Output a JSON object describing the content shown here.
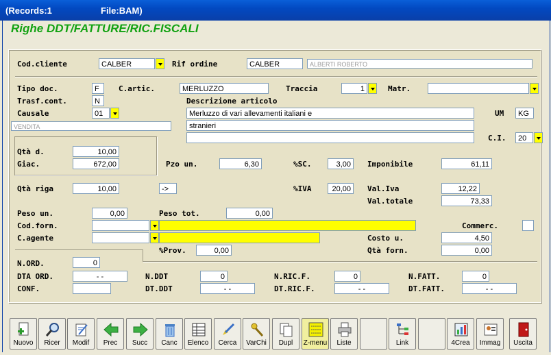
{
  "window": {
    "records": "(Records:1",
    "file": "File:BAM)"
  },
  "heading": "Righe DDT/FATTURE/RIC.FISCALI",
  "labels": {
    "cod_cliente": "Cod.cliente",
    "rif_ordine": "Rif ordine",
    "tipo_doc": "Tipo doc.",
    "c_artic": "C.artic.",
    "traccia": "Traccia",
    "matr": "Matr.",
    "trasf_cont": "Trasf.cont.",
    "descrizione": "Descrizione articolo",
    "causale": "Causale",
    "um": "UM",
    "ci": "C.I.",
    "qta_d": "Qtà d.",
    "giac": "Giac.",
    "pzo_un": "Pzo un.",
    "sc": "%SC.",
    "imponibile": "Imponibile",
    "qta_riga": "Qtà riga",
    "iva": "%IVA",
    "val_iva": "Val.Iva",
    "val_totale": "Val.totale",
    "peso_un": "Peso un.",
    "peso_tot": "Peso tot.",
    "cod_forn": "Cod.forn.",
    "commerc": "Commerc.",
    "c_agente": "C.agente",
    "costo_u": "Costo u.",
    "prov": "%Prov.",
    "qta_forn": "Qtà forn.",
    "n_ord": "N.ORD.",
    "dta_ord": "DTA ORD.",
    "n_ddt": "N.DDT",
    "n_ric_f": "N.RIC.F.",
    "n_fatt": "N.FATT.",
    "conf": "CONF.",
    "dt_ddt": "DT.DDT",
    "dt_ric_f": "DT.RIC.F.",
    "dt_fatt": "DT.FATT."
  },
  "values": {
    "cod_cliente": "CALBER",
    "rif_ordine": "CALBER",
    "cliente_nome": "ALBERTI ROBERTO",
    "tipo_doc": "F",
    "c_artic": "MERLUZZO",
    "traccia": "1",
    "matr": "",
    "trasf_cont": "N",
    "causale": "01",
    "causale_desc": "VENDITA",
    "descr1": "Merluzzo di vari allevamenti italiani e",
    "descr2": "stranieri",
    "descr3": "",
    "um": "KG",
    "ci": "20",
    "qta_d": "10,00",
    "giac": "672,00",
    "pzo_un": "6,30",
    "sc": "3,00",
    "imponibile": "61,11",
    "qta_riga": "10,00",
    "arrow": "->",
    "iva": "20,00",
    "val_iva": "12,22",
    "val_totale": "73,33",
    "peso_un": "0,00",
    "peso_tot": "0,00",
    "cod_forn": "",
    "cod_forn_desc": "",
    "commerc": "",
    "c_agente": "",
    "c_agente_desc": "",
    "costo_u": "4,50",
    "prov": "0,00",
    "qta_forn": "0,00",
    "n_ord": "0",
    "dta_ord": "-   -",
    "n_ddt": "0",
    "n_ric_f": "0",
    "n_fatt": "0",
    "conf": "",
    "dt_ddt": "-   -",
    "dt_ric_f": "-   -",
    "dt_fatt": "-   -"
  },
  "toolbar": [
    {
      "name": "nuovo",
      "label": "Nuovo",
      "icon": "new-doc-plus-icon"
    },
    {
      "name": "ricer",
      "label": "Ricer",
      "icon": "magnifier-icon"
    },
    {
      "name": "modif",
      "label": "Modif",
      "icon": "edit-doc-icon"
    },
    {
      "name": "prec",
      "label": "Prec",
      "icon": "arrow-left-icon"
    },
    {
      "name": "succ",
      "label": "Succ",
      "icon": "arrow-right-icon"
    },
    {
      "name": "canc",
      "label": "Canc",
      "icon": "trash-icon"
    },
    {
      "name": "elenco",
      "label": "Elenco",
      "icon": "list-icon"
    },
    {
      "name": "cerca",
      "label": "Cerca",
      "icon": "find-icon"
    },
    {
      "name": "varchi",
      "label": "VarChi",
      "icon": "keys-icon"
    },
    {
      "name": "dupl",
      "label": "Dupl",
      "icon": "duplicate-icon"
    },
    {
      "name": "zmenu",
      "label": "Z-menu",
      "icon": "zmenu-icon"
    },
    {
      "name": "liste",
      "label": "Liste",
      "icon": "printer-icon"
    },
    {
      "name": "link",
      "label": "Link",
      "icon": "tree-icon"
    },
    {
      "name": "4crea",
      "label": "4Crea",
      "icon": "chart-icon"
    },
    {
      "name": "immag",
      "label": "Immag",
      "icon": "image-icon"
    },
    {
      "name": "uscita",
      "label": "Uscita",
      "icon": "exit-door-icon"
    }
  ],
  "colors": {
    "heading": "#12a212",
    "titlebar": "#0249c1",
    "highlight": "#ffff00"
  }
}
